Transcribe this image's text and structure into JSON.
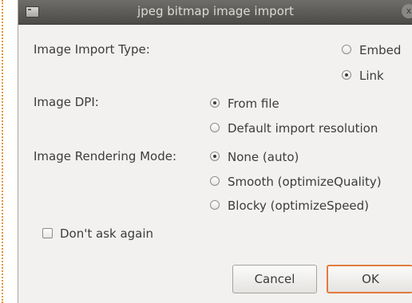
{
  "window": {
    "title": "jpeg bitmap image import",
    "close_glyph": "x"
  },
  "import_type": {
    "label": "Image Import Type:",
    "options": [
      {
        "label": "Embed",
        "selected": false
      },
      {
        "label": "Link",
        "selected": true
      }
    ]
  },
  "dpi": {
    "label": "Image DPI:",
    "options": [
      {
        "label": "From file",
        "selected": true
      },
      {
        "label": "Default import resolution",
        "selected": false
      }
    ]
  },
  "rendering": {
    "label": "Image Rendering Mode:",
    "options": [
      {
        "label": "None (auto)",
        "selected": true
      },
      {
        "label": "Smooth (optimizeQuality)",
        "selected": false
      },
      {
        "label": "Blocky (optimizeSpeed)",
        "selected": false
      }
    ]
  },
  "dont_ask": {
    "label": "Don't ask again",
    "checked": false
  },
  "buttons": {
    "cancel": "Cancel",
    "ok": "OK"
  },
  "colors": {
    "titlebar": "#4c4b47",
    "dialog_bg": "#f2f1f0",
    "focus_accent": "#e27b3f",
    "page_edge": "#e8942e"
  },
  "icons": {
    "window_icon": "app-window-icon",
    "close": "close-icon"
  }
}
